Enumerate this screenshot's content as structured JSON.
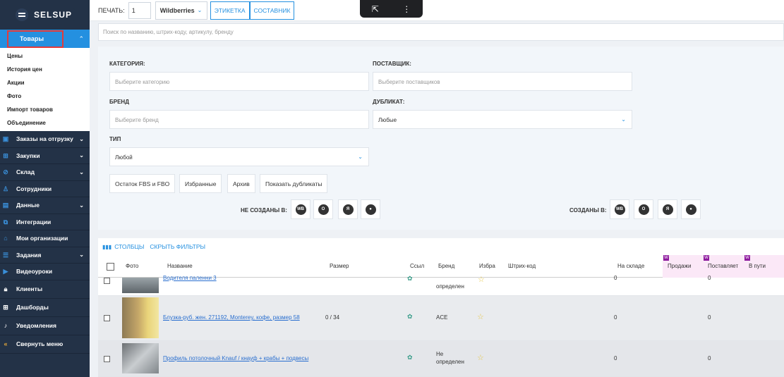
{
  "brand": {
    "name": "SELSUP"
  },
  "sidebar": {
    "active": "Товары",
    "submenu": [
      "Цены",
      "История цен",
      "Акции",
      "Фото",
      "Импорт товаров",
      "Объединение"
    ],
    "items": [
      {
        "label": "Заказы на отгрузку",
        "icon": "box-icon",
        "chev": true
      },
      {
        "label": "Закупки",
        "icon": "cart-icon",
        "chev": true
      },
      {
        "label": "Склад",
        "icon": "warehouse-icon",
        "chev": true
      },
      {
        "label": "Сотрудники",
        "icon": "user-icon",
        "chev": false
      },
      {
        "label": "Данные",
        "icon": "data-icon",
        "chev": true
      },
      {
        "label": "Интеграции",
        "icon": "plug-icon",
        "chev": false
      },
      {
        "label": "Мои организации",
        "icon": "org-icon",
        "chev": false
      },
      {
        "label": "Задания",
        "icon": "task-icon",
        "chev": true
      },
      {
        "label": "Видеоуроки",
        "icon": "video-icon",
        "chev": false
      },
      {
        "label": "Клиенты",
        "icon": "lock-icon",
        "chev": false
      },
      {
        "label": "Дашборды",
        "icon": "grid-icon",
        "chev": false
      },
      {
        "label": "Уведомления",
        "icon": "bell-icon",
        "chev": false
      },
      {
        "label": "Свернуть меню",
        "icon": "collapse-icon",
        "chev": false
      }
    ]
  },
  "topbar": {
    "print_label": "ПЕЧАТЬ:",
    "qty": "1",
    "marketplace": "Wildberries",
    "label_btn": "ЭТИКЕТКА",
    "compose_btn": "СОСТАВНИК"
  },
  "search": {
    "placeholder": "Поиск по названию, штрих-коду, артикулу, бренду"
  },
  "filters": {
    "category_label": "КАТЕГОРИЯ:",
    "category_placeholder": "Выберите категорию",
    "supplier_label": "ПОСТАВЩИК:",
    "supplier_placeholder": "Выберите поставщиков",
    "brand_label": "БРЕНД",
    "brand_placeholder": "Выберите бренд",
    "duplicate_label": "ДУБЛИКАТ:",
    "duplicate_value": "Любые",
    "type_label": "ТИП",
    "type_value": "Любой",
    "buttons": [
      "Остаток FBS и FBO",
      "Избранные",
      "Архив",
      "Показать дубликаты"
    ],
    "not_created_label": "НЕ СОЗДАНЫ В:",
    "created_label": "СОЗДАНЫ В:",
    "mp_icons": [
      "WB",
      "O",
      "Я",
      "●"
    ]
  },
  "table": {
    "columns_btn": "СТОЛБЦЫ",
    "hide_filters_btn": "СКРЫТЬ ФИЛЬТРЫ",
    "headers": {
      "photo": "Фото",
      "name": "Название",
      "size": "Размер",
      "link": "Ссыл",
      "brand": "Бренд",
      "fav": "Избра",
      "barcode": "Штрих-код",
      "stock": "На складе",
      "sales": "Продажи",
      "supplied": "Поставляет",
      "transit": "В пути"
    },
    "wb_tag": "W",
    "rows": [
      {
        "name": "Водителя паленни 3",
        "size": "",
        "brand": "определен",
        "stock": "0",
        "supplied": "0"
      },
      {
        "name": "Блузка-руб. жен. 271192, Monterey, кофе, размер 58",
        "size": "0 / 34",
        "brand": "ACE",
        "stock": "0",
        "supplied": "0"
      },
      {
        "name": "Профиль потолочный Knauf / кнауф + крабы + подвесы",
        "size": "",
        "brand": "Не определен",
        "stock": "0",
        "supplied": "0"
      }
    ]
  },
  "colors": {
    "accent": "#2490e0",
    "sidebar": "#233247",
    "highlight": "#e33b3b",
    "wb": "#8e1b9e"
  }
}
